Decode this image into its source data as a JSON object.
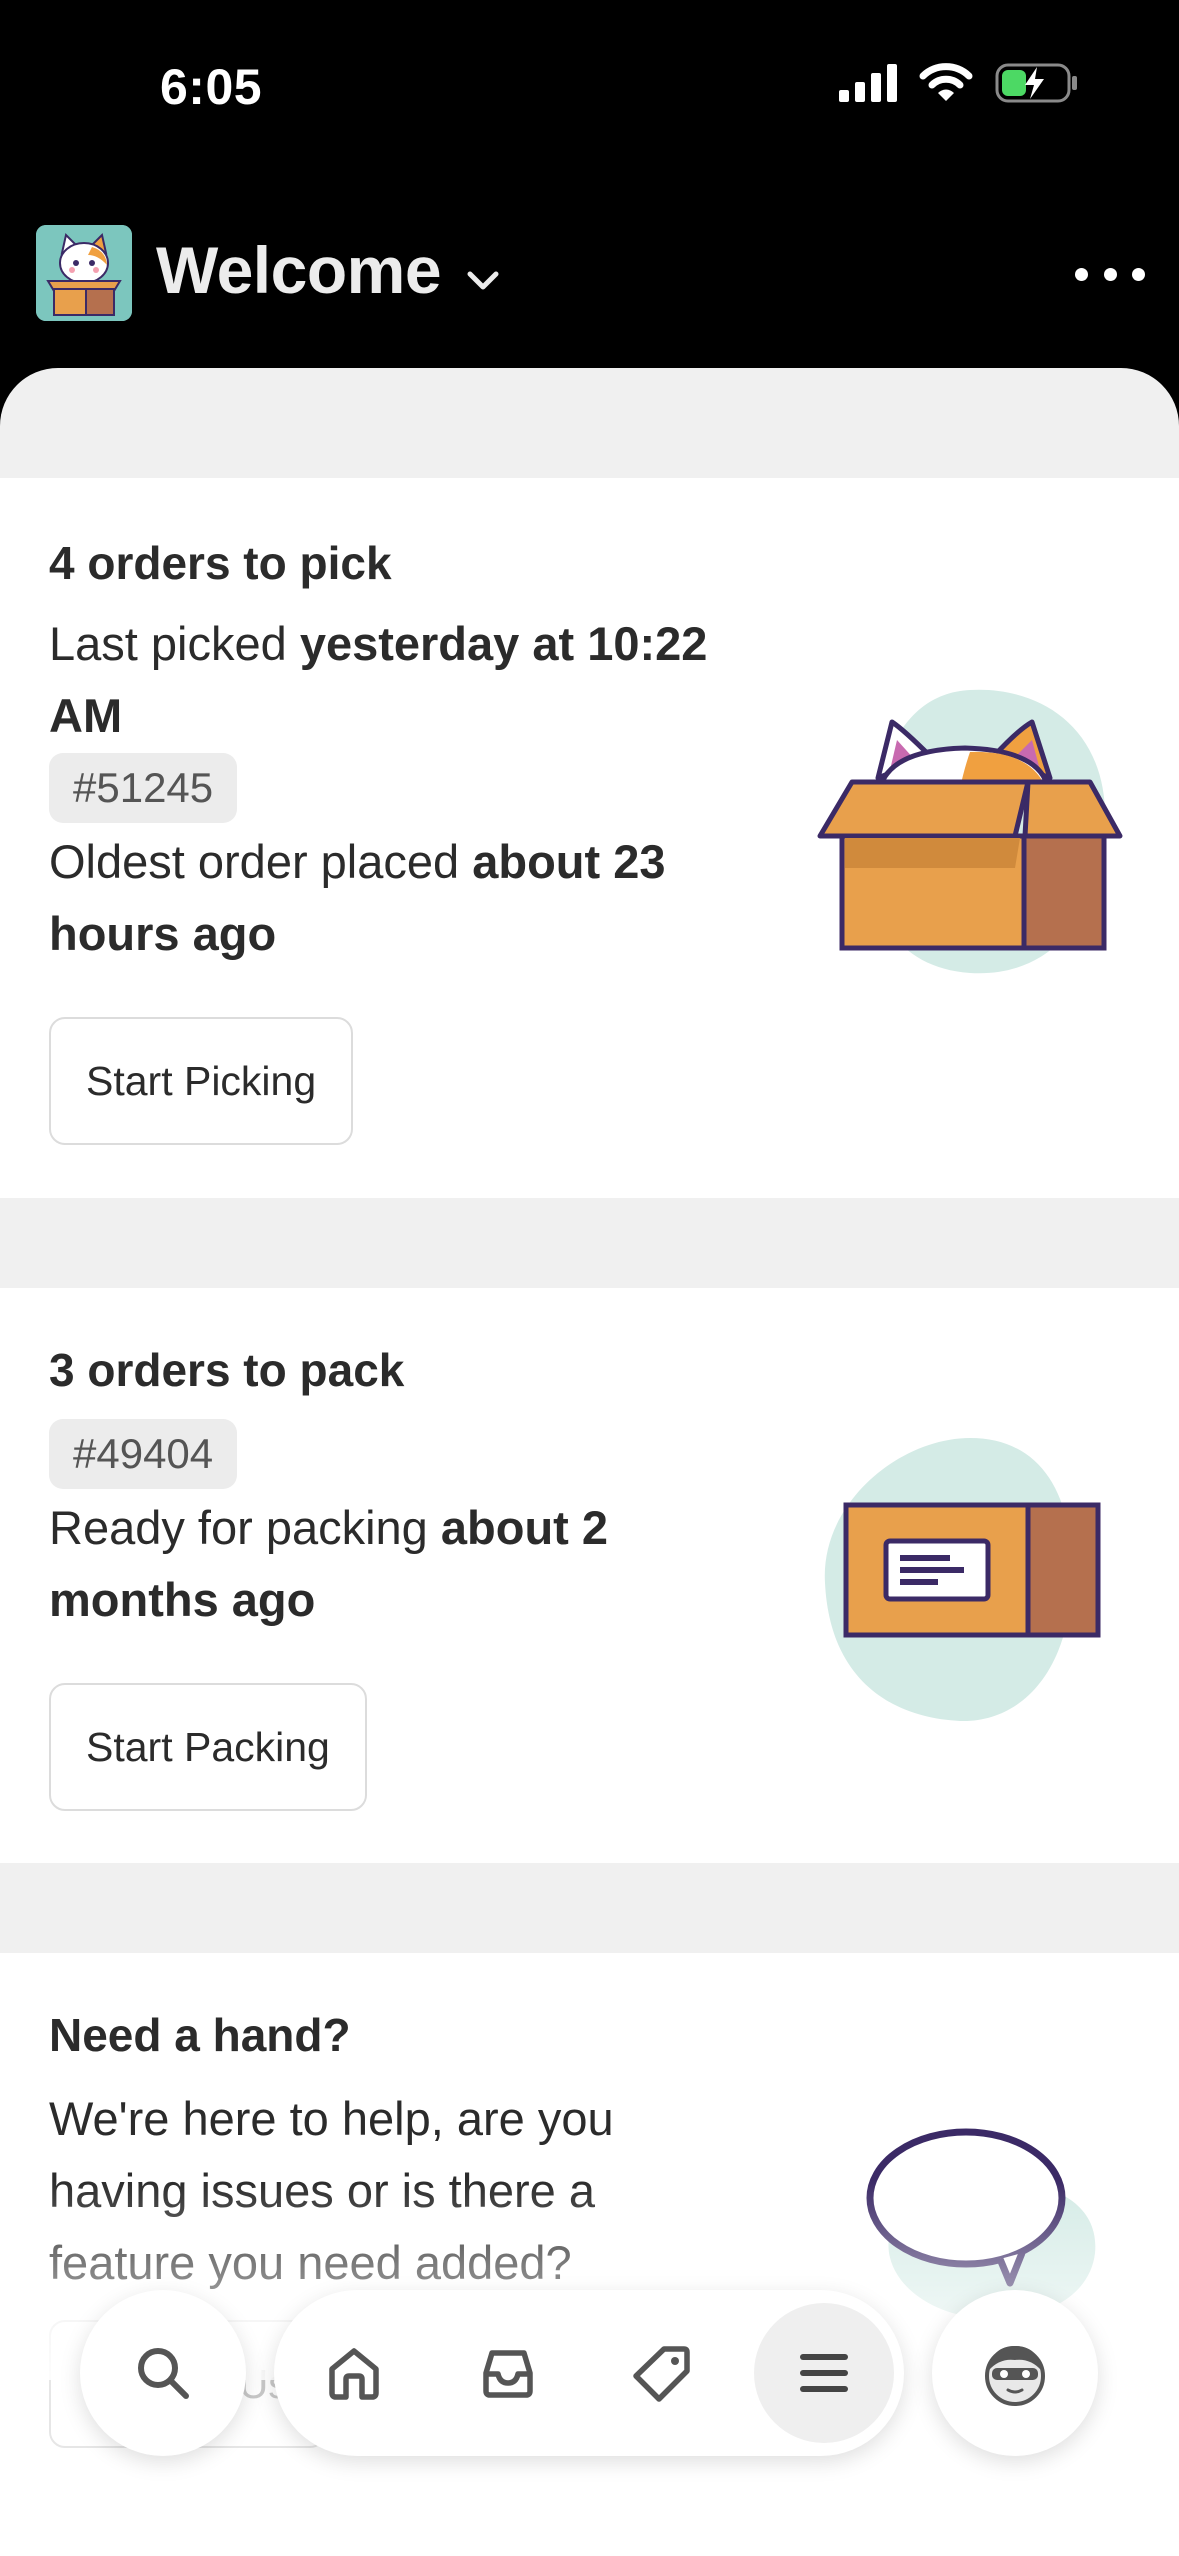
{
  "status_bar": {
    "time": "6:05"
  },
  "header": {
    "title": "Welcome"
  },
  "cards": {
    "pick": {
      "title": "4 orders to pick",
      "last_picked_prefix": "Last picked ",
      "last_picked_value": "yesterday at 10:22 AM",
      "order_number": "#51245",
      "oldest_prefix": "Oldest order placed ",
      "oldest_value": "about 23 hours ago",
      "button_label": "Start Picking"
    },
    "pack": {
      "title": "3 orders to pack",
      "order_number": "#49404",
      "ready_prefix": "Ready for packing ",
      "ready_value": "about 2 months ago",
      "button_label": "Start Packing"
    },
    "help": {
      "title": "Need a hand?",
      "text": "We're here to help, are you having issues or is there a feature you need added?",
      "button_label": "Contact Us"
    }
  },
  "bottom_nav": {
    "items": [
      {
        "icon": "search-icon"
      },
      {
        "icon": "home-icon"
      },
      {
        "icon": "inbox-icon"
      },
      {
        "icon": "tag-icon"
      },
      {
        "icon": "menu-icon",
        "active": true
      },
      {
        "icon": "avatar-icon"
      }
    ]
  },
  "colors": {
    "box_orange": "#e8a04c",
    "box_dark": "#b5704e",
    "outline": "#3b2a66",
    "blob": "#d4ebe6"
  }
}
